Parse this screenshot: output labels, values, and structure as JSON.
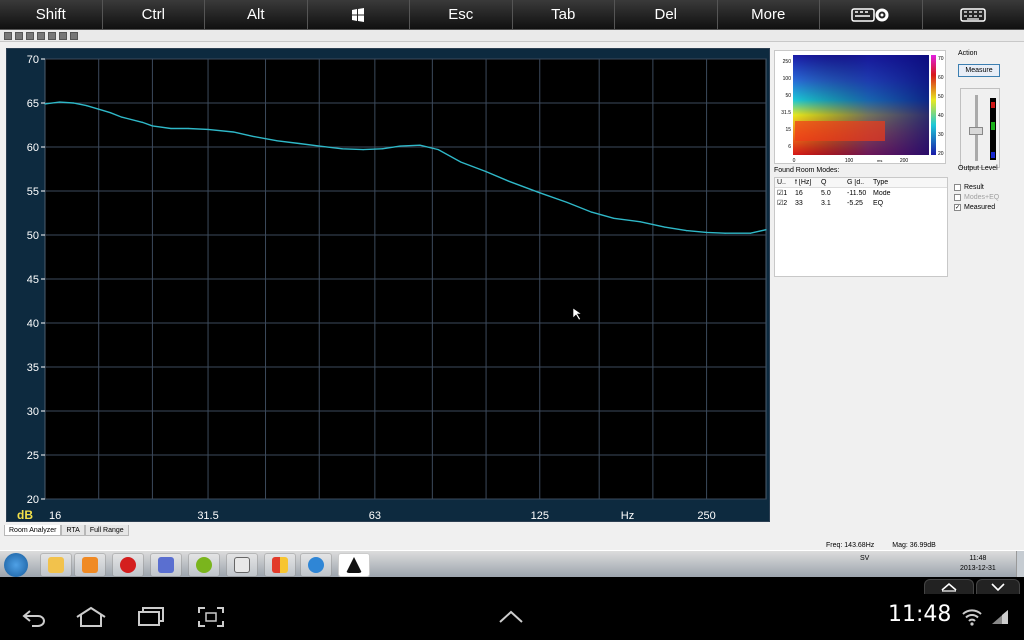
{
  "keyboard_bar": {
    "keys": [
      "Shift",
      "Ctrl",
      "Alt",
      "",
      "Esc",
      "Tab",
      "Del",
      "More",
      "",
      ""
    ],
    "windows_icon": "windows-logo-icon",
    "settings_icon": "keyboard-settings-icon",
    "keyboard_icon": "keyboard-icon"
  },
  "graph": {
    "y_unit": "dB",
    "x_unit": "Hz",
    "y_ticks": [
      "70",
      "65",
      "60",
      "55",
      "50",
      "45",
      "40",
      "35",
      "30",
      "25",
      "20"
    ],
    "x_ticks": [
      "16",
      "31.5",
      "63",
      "125",
      "250"
    ],
    "colors": {
      "background": "#000000",
      "frame": "#0d2a3f",
      "grid": "#3c4a5c",
      "curve": "#2fb8c8",
      "db_label": "#f3e04a"
    }
  },
  "chart_data": {
    "type": "line",
    "x_scale": "log",
    "xlim": [
      16,
      320
    ],
    "ylim": [
      20,
      70
    ],
    "xlabel": "Hz",
    "ylabel": "dB",
    "grid": true,
    "series": [
      {
        "x": [
          16,
          17,
          18,
          19,
          20,
          21,
          22,
          24,
          25,
          27,
          29,
          31.5,
          35,
          38,
          42,
          46,
          50,
          55,
          60,
          65,
          70,
          76,
          82,
          90,
          100,
          110,
          125,
          140,
          155,
          170,
          190,
          210,
          230,
          250,
          270,
          300,
          320
        ],
        "y": [
          64.9,
          65.1,
          65.0,
          64.7,
          64.3,
          63.9,
          63.4,
          62.8,
          62.4,
          62.1,
          62.1,
          62.0,
          61.7,
          61.2,
          60.7,
          60.4,
          60.1,
          59.8,
          59.7,
          59.8,
          60.1,
          60.2,
          59.7,
          58.3,
          57.2,
          56.1,
          54.8,
          53.7,
          52.6,
          51.9,
          51.5,
          50.9,
          50.5,
          50.3,
          50.2,
          50.2,
          50.6
        ]
      }
    ]
  },
  "waterfall": {
    "y_ticks": [
      "250",
      "100",
      "50",
      "31.5",
      "15",
      "6"
    ],
    "x_ticks": [
      "0",
      "100",
      "200"
    ],
    "x_unit": "ms",
    "scale_ticks": [
      "70",
      "60",
      "50",
      "40",
      "30",
      "20"
    ]
  },
  "action": {
    "title": "Action",
    "measure_button": "Measure",
    "output_level_label": "Output Level",
    "slider_level": 0.45
  },
  "options": [
    {
      "label": "Result",
      "checked": false,
      "enabled": true
    },
    {
      "label": "Modes+EQ",
      "checked": false,
      "enabled": false
    },
    {
      "label": "Measured",
      "checked": true,
      "enabled": true
    }
  ],
  "room_modes": {
    "title": "Found Room Modes:",
    "columns": [
      "U..",
      "f [Hz]",
      "Q",
      "G [d..",
      "Type"
    ],
    "rows": [
      {
        "use": true,
        "index": "1",
        "freq": "16",
        "q": "5.0",
        "gain": "-11.50",
        "type": "Mode"
      },
      {
        "use": true,
        "index": "2",
        "freq": "33",
        "q": "3.1",
        "gain": "-5.25",
        "type": "EQ"
      }
    ]
  },
  "tabs": [
    {
      "label": "Room Analyzer",
      "active": true
    },
    {
      "label": "RTA",
      "active": false
    },
    {
      "label": "Full Range",
      "active": false
    }
  ],
  "status": {
    "freq": "Freq: 143.68Hz",
    "mag": "Mag: 36.99dB"
  },
  "taskbar": {
    "lang": "SV",
    "time": "11:48",
    "date": "2013-12-31",
    "apps": [
      "explorer-icon",
      "media-player-icon",
      "opera-icon",
      "dsp-icon",
      "spotify-icon",
      "calculator-icon",
      "file-manager-icon",
      "browser-icon",
      "xtz-app-icon"
    ]
  },
  "android": {
    "time": "11:48"
  }
}
